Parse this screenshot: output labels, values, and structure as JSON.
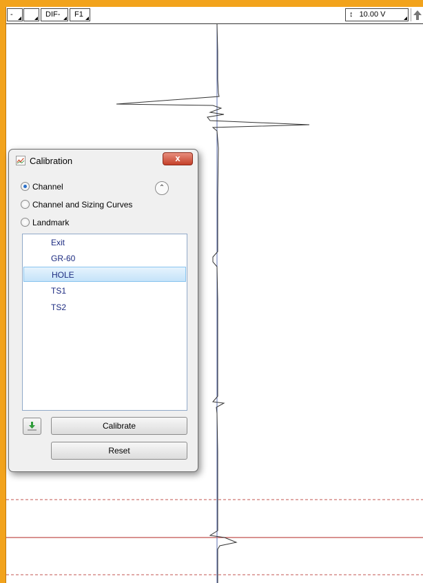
{
  "toolbar": {
    "field1": "-",
    "field2": "",
    "field3": "DIF-",
    "field4": "F1",
    "scale_icon": "vertical-scale-icon",
    "scale_value": "10.00 V",
    "arrow_icon": "up-arrow-icon"
  },
  "dialog": {
    "title": "Calibration",
    "close_label": "x",
    "radio_channel": "Channel",
    "radio_channel_sizing": "Channel and Sizing Curves",
    "radio_landmark": "Landmark",
    "selected_mode": "Channel",
    "items": [
      {
        "label": "Exit"
      },
      {
        "label": "GR-60"
      },
      {
        "label": "HOLE"
      },
      {
        "label": "TS1"
      },
      {
        "label": "TS2"
      }
    ],
    "selected_item": "HOLE",
    "calibrate_label": "Calibrate",
    "reset_label": "Reset"
  },
  "colors": {
    "frame": "#f2a31c",
    "trace": "#333333",
    "marker_solid": "#c0504d",
    "marker_dashed": "#c0504d",
    "selection": "#c5e3f9"
  }
}
